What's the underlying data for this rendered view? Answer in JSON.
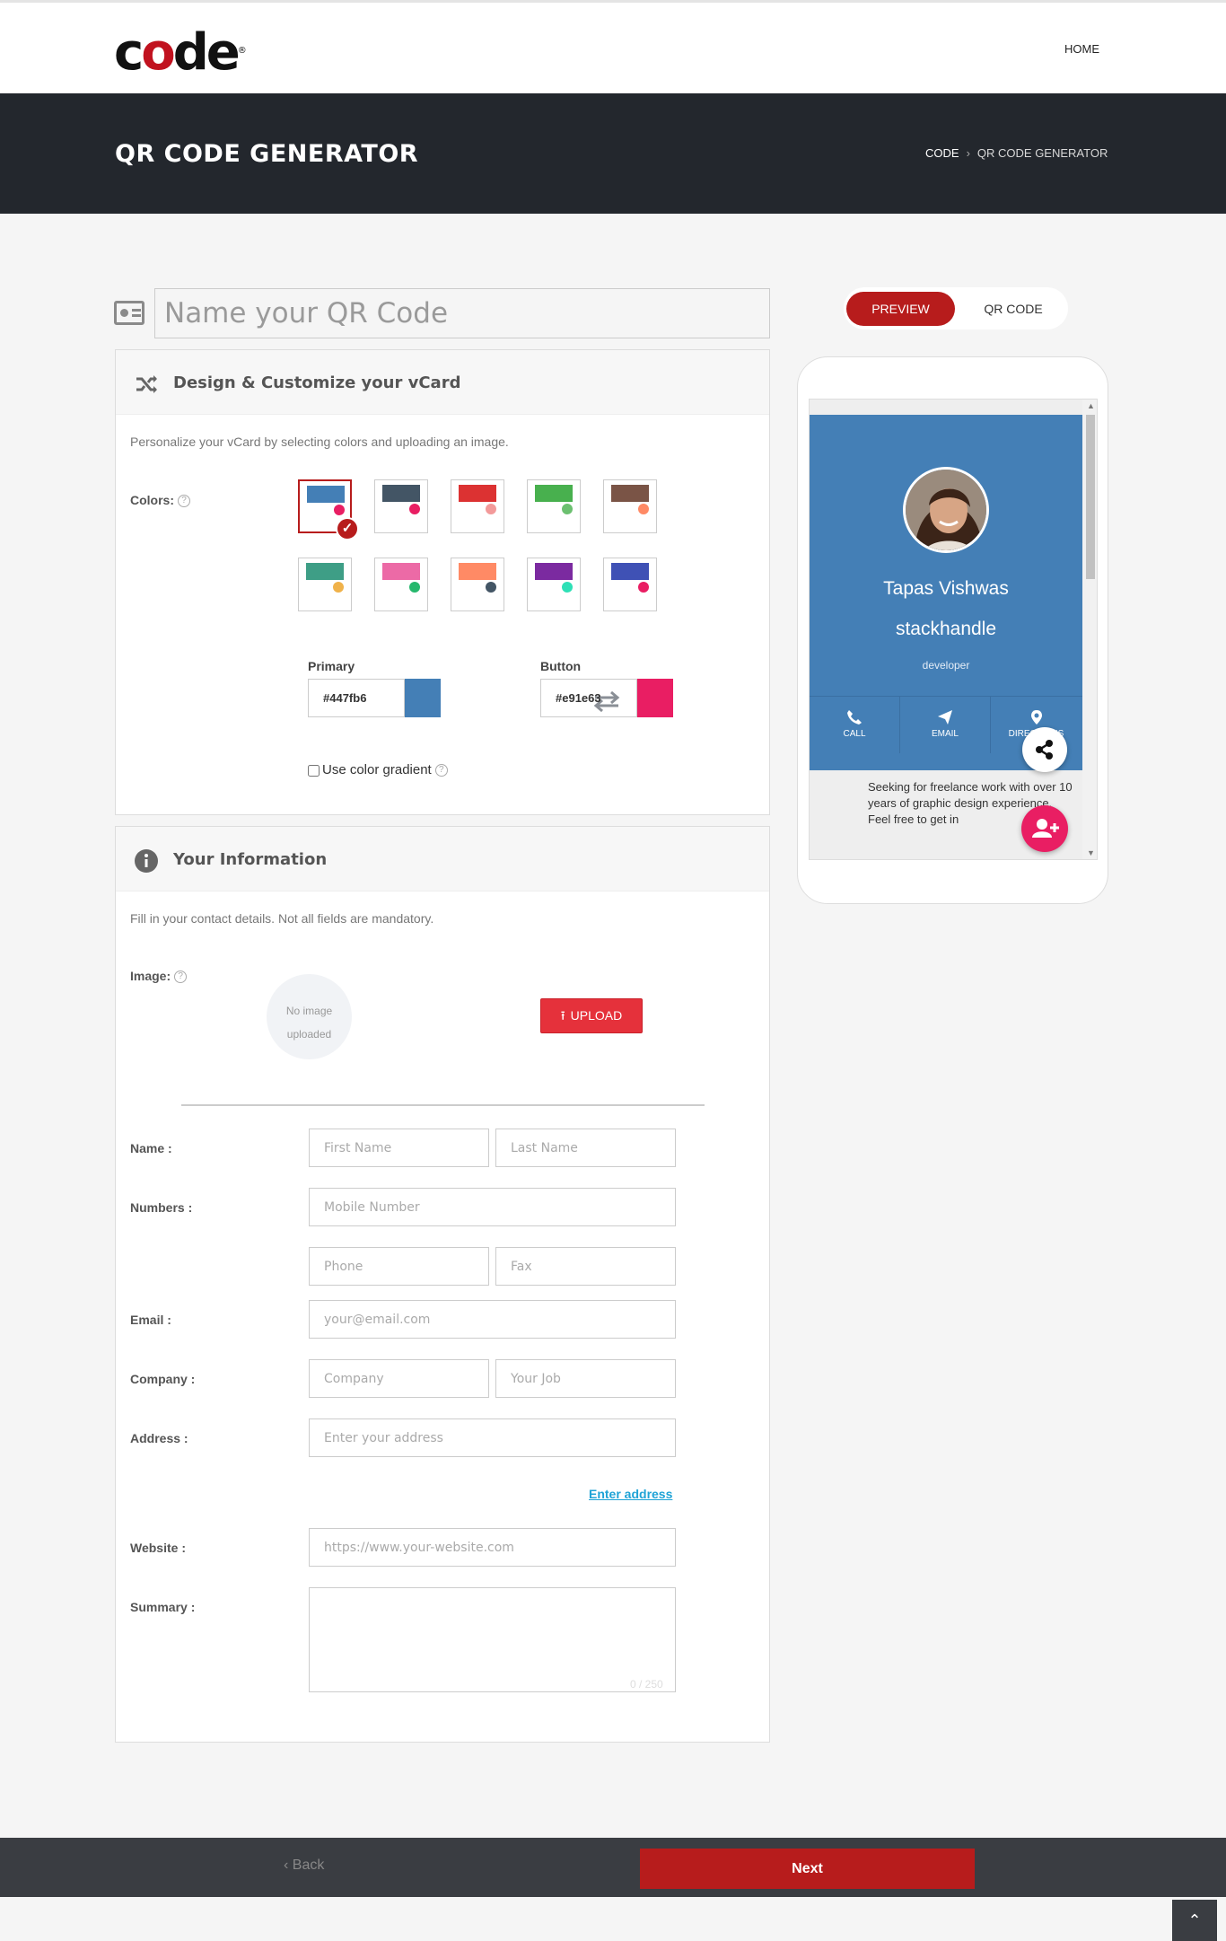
{
  "header": {
    "logo_text": "code",
    "logo_mark": "®",
    "nav_home": "HOME"
  },
  "banner": {
    "title": "QR CODE GENERATOR",
    "breadcrumb": [
      "CODE",
      "QR CODE GENERATOR"
    ]
  },
  "qr_name": {
    "placeholder": "Name your QR Code"
  },
  "design": {
    "title": "Design & Customize your vCard",
    "description": "Personalize your vCard by selecting colors and uploading an image.",
    "colors_label": "Colors:",
    "help": "?",
    "swatches": [
      {
        "bar": "#447fb6",
        "dot": "#e91e63",
        "selected": true
      },
      {
        "bar": "#435565",
        "dot": "#e91e63",
        "selected": false
      },
      {
        "bar": "#dc3232",
        "dot": "#f39a9a",
        "selected": false
      },
      {
        "bar": "#48b04e",
        "dot": "#6cc070",
        "selected": false
      },
      {
        "bar": "#7a5446",
        "dot": "#ff8a65",
        "selected": false
      },
      {
        "bar": "#3e9e86",
        "dot": "#f0b24a",
        "selected": false
      },
      {
        "bar": "#ec6aa6",
        "dot": "#26b86d",
        "selected": false
      },
      {
        "bar": "#ff8a65",
        "dot": "#435565",
        "selected": false
      },
      {
        "bar": "#7b2aa0",
        "dot": "#2ee0b6",
        "selected": false
      },
      {
        "bar": "#3f51b5",
        "dot": "#e91e63",
        "selected": false
      }
    ],
    "primary_label": "Primary",
    "primary_value": "#447fb6",
    "primary_color": "#447fb6",
    "button_label": "Button",
    "button_value": "#e91e63",
    "button_color": "#e91e63",
    "gradient_label": "Use color gradient"
  },
  "info": {
    "title": "Your Information",
    "description": "Fill in your contact details. Not all fields are mandatory.",
    "image_label": "Image:",
    "no_image": [
      "No image",
      "uploaded"
    ],
    "upload": "UPLOAD",
    "name_label": "Name :",
    "first_name_ph": "First Name",
    "last_name_ph": "Last Name",
    "numbers_label": "Numbers :",
    "mobile_ph": "Mobile Number",
    "phone_ph": "Phone",
    "fax_ph": "Fax",
    "email_label": "Email :",
    "email_ph": "your@email.com",
    "company_label": "Company :",
    "company_ph": "Company",
    "job_ph": "Your Job",
    "address_label": "Address :",
    "address_ph": "Enter your address",
    "enter_address": "Enter address",
    "website_label": "Website :",
    "website_ph": "https://www.your-website.com",
    "summary_label": "Summary :",
    "summary_counter": "0 / 250"
  },
  "preview": {
    "tab_preview": "PREVIEW",
    "tab_qr": "QR CODE",
    "name": "Tapas Vishwas",
    "org": "stackhandle",
    "job": "developer",
    "actions": [
      "CALL",
      "EMAIL",
      "DIRECTIONS"
    ],
    "summary": "Seeking for freelance work with over 10 years of graphic design experience. Feel free to get in"
  },
  "footer": {
    "back": "Back",
    "next": "Next"
  }
}
